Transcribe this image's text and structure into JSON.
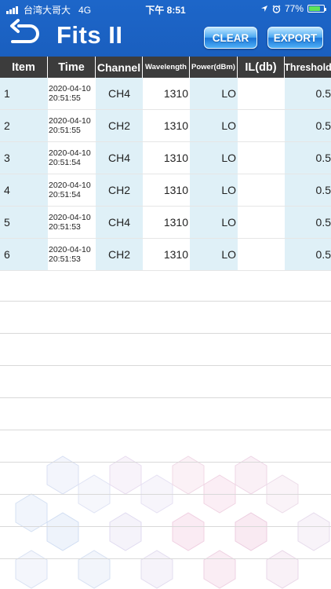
{
  "status_bar": {
    "carrier": "台湾大哥大",
    "network": "4G",
    "time": "下午 8:51",
    "battery": "77%",
    "battery_level": 0.77
  },
  "header": {
    "title": "Fits II",
    "clear_label": "CLEAR",
    "export_label": "EXPORT"
  },
  "table": {
    "columns": [
      "Item",
      "Time",
      "Channel",
      "Wavelength",
      "Power(dBm)",
      "IL(db)",
      "Threshold"
    ],
    "rows": [
      {
        "item": "1",
        "date": "2020-04-10",
        "time": "20:51:55",
        "channel": "CH4",
        "wavelength": "1310",
        "power": "LO",
        "il": "",
        "threshold": "0.5"
      },
      {
        "item": "2",
        "date": "2020-04-10",
        "time": "20:51:55",
        "channel": "CH2",
        "wavelength": "1310",
        "power": "LO",
        "il": "",
        "threshold": "0.5"
      },
      {
        "item": "3",
        "date": "2020-04-10",
        "time": "20:51:54",
        "channel": "CH4",
        "wavelength": "1310",
        "power": "LO",
        "il": "",
        "threshold": "0.5"
      },
      {
        "item": "4",
        "date": "2020-04-10",
        "time": "20:51:54",
        "channel": "CH2",
        "wavelength": "1310",
        "power": "LO",
        "il": "",
        "threshold": "0.5"
      },
      {
        "item": "5",
        "date": "2020-04-10",
        "time": "20:51:53",
        "channel": "CH4",
        "wavelength": "1310",
        "power": "LO",
        "il": "",
        "threshold": "0.5"
      },
      {
        "item": "6",
        "date": "2020-04-10",
        "time": "20:51:53",
        "channel": "CH2",
        "wavelength": "1310",
        "power": "LO",
        "il": "",
        "threshold": "0.5"
      }
    ]
  },
  "colors": {
    "header_blue": "#1a5fbf",
    "column_tint": "#dff0f7",
    "table_header": "#3c3c3c",
    "button_blue": "#1a74d8"
  },
  "icons": {
    "back": "back-arrow-icon",
    "location": "location-arrow-icon",
    "alarm": "alarm-clock-icon",
    "battery": "battery-charging-icon"
  }
}
